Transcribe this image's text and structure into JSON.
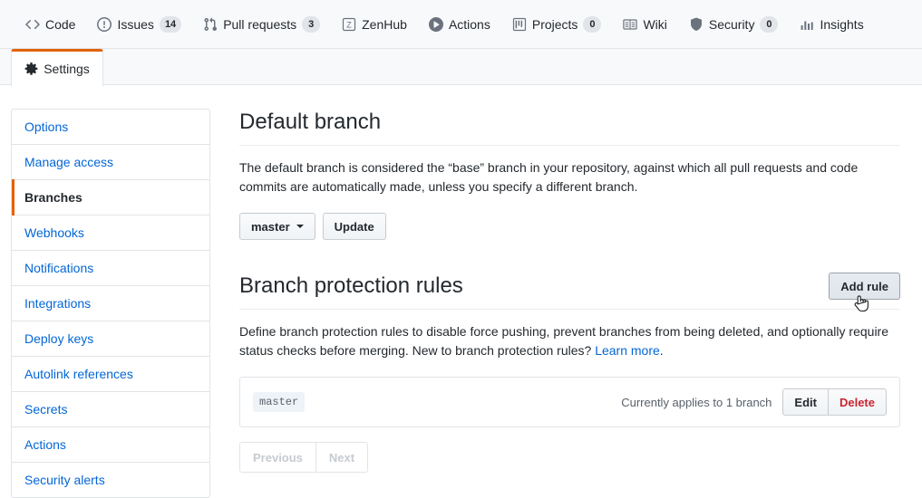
{
  "repo_nav": {
    "items": [
      {
        "label": "Code",
        "icon": "code-icon",
        "count": null
      },
      {
        "label": "Issues",
        "icon": "issue-opened-icon",
        "count": "14"
      },
      {
        "label": "Pull requests",
        "icon": "git-pull-request-icon",
        "count": "3"
      },
      {
        "label": "ZenHub",
        "icon": "zenhub-icon",
        "count": null
      },
      {
        "label": "Actions",
        "icon": "play-icon",
        "count": null
      },
      {
        "label": "Projects",
        "icon": "project-icon",
        "count": "0"
      },
      {
        "label": "Wiki",
        "icon": "book-icon",
        "count": null
      },
      {
        "label": "Security",
        "icon": "shield-icon",
        "count": "0"
      },
      {
        "label": "Insights",
        "icon": "graph-icon",
        "count": null
      }
    ]
  },
  "tab_bar": {
    "settings_label": "Settings",
    "settings_icon": "gear-icon",
    "active_accent": "#e36209"
  },
  "sidebar": {
    "items": [
      {
        "label": "Options",
        "selected": false
      },
      {
        "label": "Manage access",
        "selected": false
      },
      {
        "label": "Branches",
        "selected": true
      },
      {
        "label": "Webhooks",
        "selected": false
      },
      {
        "label": "Notifications",
        "selected": false
      },
      {
        "label": "Integrations",
        "selected": false
      },
      {
        "label": "Deploy keys",
        "selected": false
      },
      {
        "label": "Autolink references",
        "selected": false
      },
      {
        "label": "Secrets",
        "selected": false
      },
      {
        "label": "Actions",
        "selected": false
      },
      {
        "label": "Security alerts",
        "selected": false
      }
    ]
  },
  "default_branch": {
    "title": "Default branch",
    "description": "The default branch is considered the “base” branch in your repository, against which all pull requests and code commits are automatically made, unless you specify a different branch.",
    "selected_branch": "master",
    "update_label": "Update"
  },
  "protection_rules": {
    "title": "Branch protection rules",
    "add_rule_label": "Add rule",
    "description_before_link": "Define branch protection rules to disable force pushing, prevent branches from being deleted, and optionally require status checks before merging. New to branch protection rules? ",
    "learn_more_label": "Learn more",
    "description_after_link": ".",
    "rows": [
      {
        "branch_pattern": "master",
        "applies_text": "Currently applies to 1 branch",
        "edit_label": "Edit",
        "delete_label": "Delete"
      }
    ],
    "pagination": {
      "previous_label": "Previous",
      "next_label": "Next"
    }
  },
  "colors": {
    "accent_orange": "#e36209",
    "link_blue": "#0366d6",
    "danger_red": "#cb2431",
    "nav_bg": "#f8f9fb",
    "border": "#e1e4e8",
    "tag_bg": "#eef3f8"
  }
}
